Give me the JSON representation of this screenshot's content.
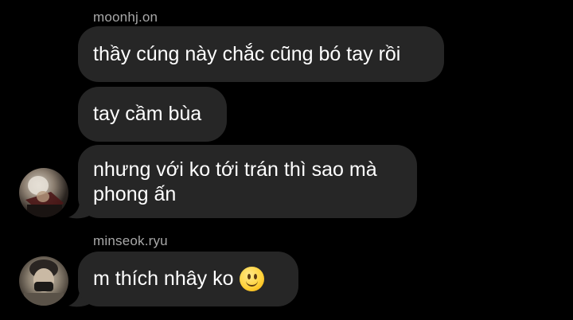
{
  "messages": [
    {
      "sender": "moonhj.on",
      "text": "thầy cúng này chắc cũng bó tay rồi"
    },
    {
      "text": "tay cầm bùa"
    },
    {
      "text_line1": "nhưng với ko tới trán thì sao mà",
      "text_line2": "phong ấn"
    },
    {
      "sender": "minseok.ryu",
      "text": "m thích nhây ko",
      "emoji": "slightly-smiling-face"
    }
  ],
  "colors": {
    "background": "#000000",
    "bubble": "#262626",
    "text": "#ffffff",
    "sender": "#a8a8a8"
  }
}
